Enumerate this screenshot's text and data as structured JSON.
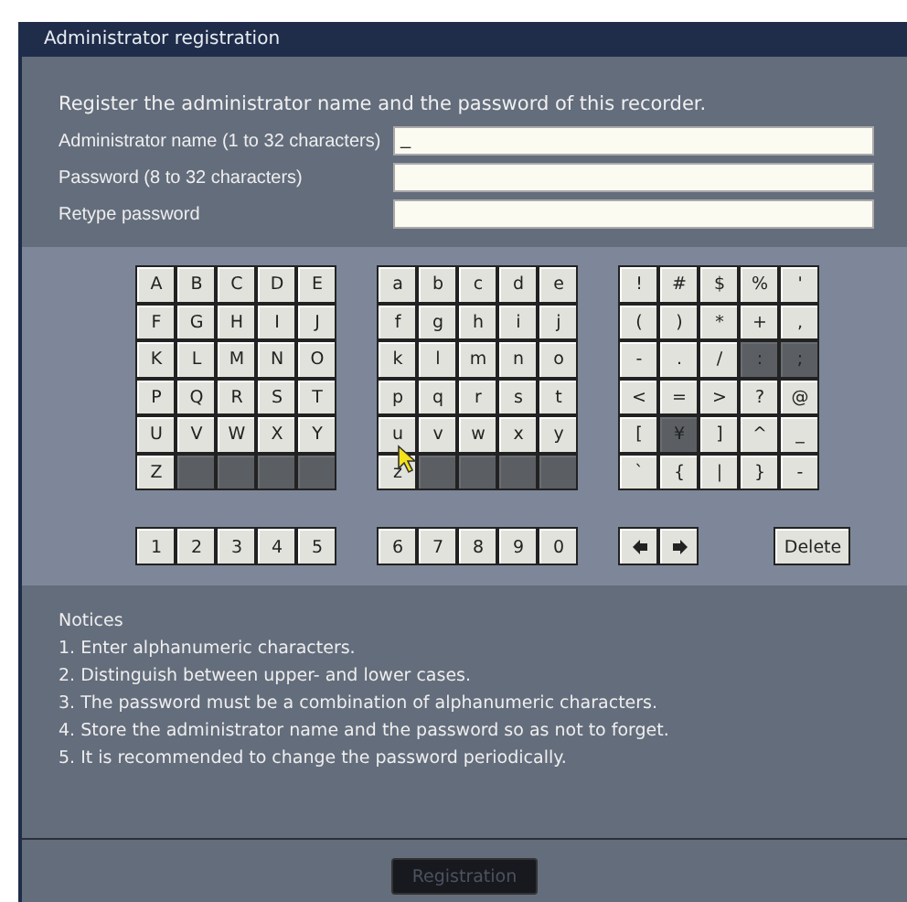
{
  "window": {
    "title": "Administrator registration"
  },
  "intro": "Register the administrator name and the password of this recorder.",
  "fields": [
    {
      "label": "Administrator name (1 to 32 characters)",
      "value": "_"
    },
    {
      "label": "Password (8 to 32 characters)"
    },
    {
      "label": "Retype password"
    }
  ],
  "keyboard": {
    "groups": [
      {
        "keys": [
          {
            "label": "A",
            "disabled": false
          },
          {
            "label": "B",
            "disabled": false
          },
          {
            "label": "C",
            "disabled": false
          },
          {
            "label": "D",
            "disabled": false
          },
          {
            "label": "E",
            "disabled": false
          },
          {
            "label": "F",
            "disabled": false
          },
          {
            "label": "G",
            "disabled": false
          },
          {
            "label": "H",
            "disabled": false
          },
          {
            "label": "I",
            "disabled": false
          },
          {
            "label": "J",
            "disabled": false
          },
          {
            "label": "K",
            "disabled": false
          },
          {
            "label": "L",
            "disabled": false
          },
          {
            "label": "M",
            "disabled": false
          },
          {
            "label": "N",
            "disabled": false
          },
          {
            "label": "O",
            "disabled": false
          },
          {
            "label": "P",
            "disabled": false
          },
          {
            "label": "Q",
            "disabled": false
          },
          {
            "label": "R",
            "disabled": false
          },
          {
            "label": "S",
            "disabled": false
          },
          {
            "label": "T",
            "disabled": false
          },
          {
            "label": "U",
            "disabled": false
          },
          {
            "label": "V",
            "disabled": false
          },
          {
            "label": "W",
            "disabled": false
          },
          {
            "label": "X",
            "disabled": false
          },
          {
            "label": "Y",
            "disabled": false
          },
          {
            "label": "Z",
            "disabled": false
          },
          {
            "kind": "blank"
          },
          {
            "kind": "blank"
          },
          {
            "kind": "blank"
          },
          {
            "kind": "blank"
          }
        ]
      },
      {
        "keys": [
          {
            "label": "a",
            "disabled": false
          },
          {
            "label": "b",
            "disabled": false
          },
          {
            "label": "c",
            "disabled": false
          },
          {
            "label": "d",
            "disabled": false
          },
          {
            "label": "e",
            "disabled": false
          },
          {
            "label": "f",
            "disabled": false
          },
          {
            "label": "g",
            "disabled": false
          },
          {
            "label": "h",
            "disabled": false
          },
          {
            "label": "i",
            "disabled": false
          },
          {
            "label": "j",
            "disabled": false
          },
          {
            "label": "k",
            "disabled": false
          },
          {
            "label": "l",
            "disabled": false
          },
          {
            "label": "m",
            "disabled": false
          },
          {
            "label": "n",
            "disabled": false
          },
          {
            "label": "o",
            "disabled": false
          },
          {
            "label": "p",
            "disabled": false
          },
          {
            "label": "q",
            "disabled": false
          },
          {
            "label": "r",
            "disabled": false
          },
          {
            "label": "s",
            "disabled": false
          },
          {
            "label": "t",
            "disabled": false
          },
          {
            "label": "u",
            "disabled": false
          },
          {
            "label": "v",
            "disabled": false
          },
          {
            "label": "w",
            "disabled": false
          },
          {
            "label": "x",
            "disabled": false
          },
          {
            "label": "y",
            "disabled": false
          },
          {
            "label": "z",
            "disabled": false
          },
          {
            "kind": "blank"
          },
          {
            "kind": "blank"
          },
          {
            "kind": "blank"
          },
          {
            "kind": "blank"
          }
        ]
      },
      {
        "keys": [
          {
            "label": "!",
            "disabled": false
          },
          {
            "label": "#",
            "disabled": false
          },
          {
            "label": "$",
            "disabled": false
          },
          {
            "label": "%",
            "disabled": false
          },
          {
            "label": "'",
            "disabled": false
          },
          {
            "label": "(",
            "disabled": false
          },
          {
            "label": ")",
            "disabled": false
          },
          {
            "label": "*",
            "disabled": false
          },
          {
            "label": "+",
            "disabled": false
          },
          {
            "label": ",",
            "disabled": false
          },
          {
            "label": "-",
            "disabled": false
          },
          {
            "label": ".",
            "disabled": false
          },
          {
            "label": "/",
            "disabled": false
          },
          {
            "label": ":",
            "disabled": true
          },
          {
            "label": ";",
            "disabled": true
          },
          {
            "label": "<",
            "disabled": false
          },
          {
            "label": "=",
            "disabled": false
          },
          {
            "label": ">",
            "disabled": false
          },
          {
            "label": "?",
            "disabled": false
          },
          {
            "label": "@",
            "disabled": false
          },
          {
            "label": "[",
            "disabled": false
          },
          {
            "label": "¥",
            "disabled": true
          },
          {
            "label": "]",
            "disabled": false
          },
          {
            "label": "^",
            "disabled": false
          },
          {
            "label": "_",
            "disabled": false
          },
          {
            "label": "`",
            "disabled": false
          },
          {
            "label": "{",
            "disabled": false
          },
          {
            "label": "|",
            "disabled": false
          },
          {
            "label": "}",
            "disabled": false
          },
          {
            "label": "-",
            "disabled": false
          }
        ]
      }
    ],
    "bottom_rows": [
      {
        "keys": [
          {
            "label": "1"
          },
          {
            "label": "2"
          },
          {
            "label": "3"
          },
          {
            "label": "4"
          },
          {
            "label": "5"
          }
        ]
      },
      {
        "keys": [
          {
            "label": "6"
          },
          {
            "label": "7"
          },
          {
            "label": "8"
          },
          {
            "label": "9"
          },
          {
            "label": "0"
          }
        ]
      },
      {
        "keys": [
          {
            "kind": "left-arrow"
          },
          {
            "kind": "right-arrow"
          }
        ]
      },
      {
        "keys": [
          {
            "label": "Delete",
            "kind": "wide"
          }
        ]
      }
    ]
  },
  "notices": {
    "title": "Notices",
    "items": [
      "1. Enter alphanumeric characters.",
      "2. Distinguish between upper- and lower cases.",
      "3. The password must be a combination of alphanumeric characters.",
      "4. Store the administrator name and the password so as not to forget.",
      "5. It is recommended to change the password periodically."
    ]
  },
  "button": {
    "label": "Registration",
    "disabled": true
  }
}
